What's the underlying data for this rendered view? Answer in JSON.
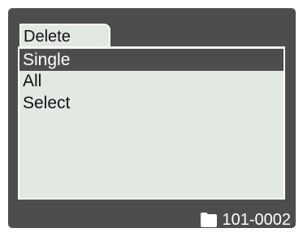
{
  "menu": {
    "tab_title": "Delete",
    "items": [
      {
        "label": "Single",
        "selected": true
      },
      {
        "label": "All",
        "selected": false
      },
      {
        "label": "Select",
        "selected": false
      }
    ]
  },
  "status": {
    "folder_icon": "folder-icon",
    "file_number": "101-0002"
  },
  "colors": {
    "background": "#4d4d4d",
    "panel": "#e2e8e2",
    "highlight": "#4d4d4d",
    "border": "#ffffff"
  }
}
